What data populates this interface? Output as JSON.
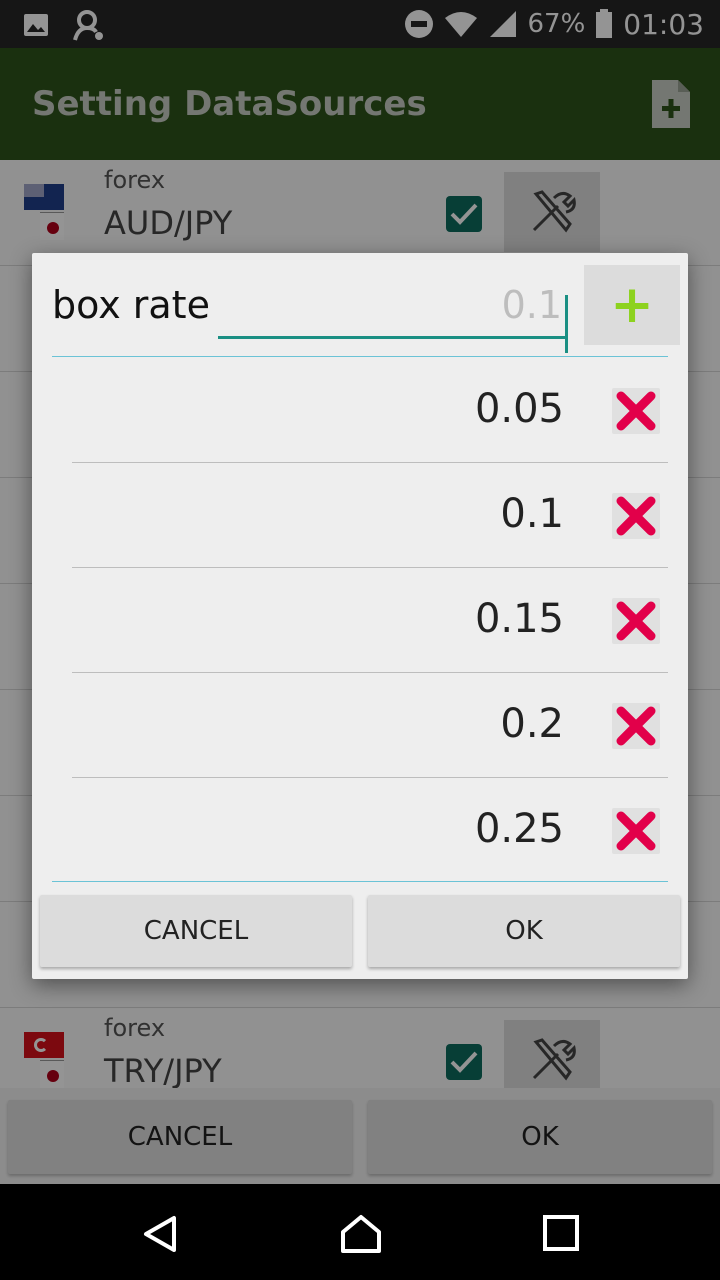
{
  "status_bar": {
    "battery": "67%",
    "time": "01:03",
    "icons": [
      "image-icon",
      "usb-debug-icon",
      "do-not-disturb-icon",
      "wifi-icon",
      "signal-icon",
      "battery-icon"
    ]
  },
  "app_bar": {
    "title": "Setting DataSources",
    "action_icon": "add-file-icon"
  },
  "background_list": {
    "rows": [
      {
        "category": "forex",
        "pair": "AUD/JPY",
        "checked": true
      },
      {
        "category": "forex",
        "pair": "TRY/JPY",
        "checked": true
      }
    ],
    "cancel_label": "CANCEL",
    "ok_label": "OK"
  },
  "dialog": {
    "label": "box rate",
    "input_value": "",
    "input_placeholder": "0.1",
    "add_icon": "+",
    "values": [
      {
        "value": "0.05"
      },
      {
        "value": "0.1"
      },
      {
        "value": "0.15"
      },
      {
        "value": "0.2"
      },
      {
        "value": "0.25"
      }
    ],
    "cancel_label": "CANCEL",
    "ok_label": "OK"
  },
  "colors": {
    "app_bar": "#2e541a",
    "accent": "#1a8f83",
    "plus": "#8dd21f",
    "delete": "#e2004a"
  }
}
